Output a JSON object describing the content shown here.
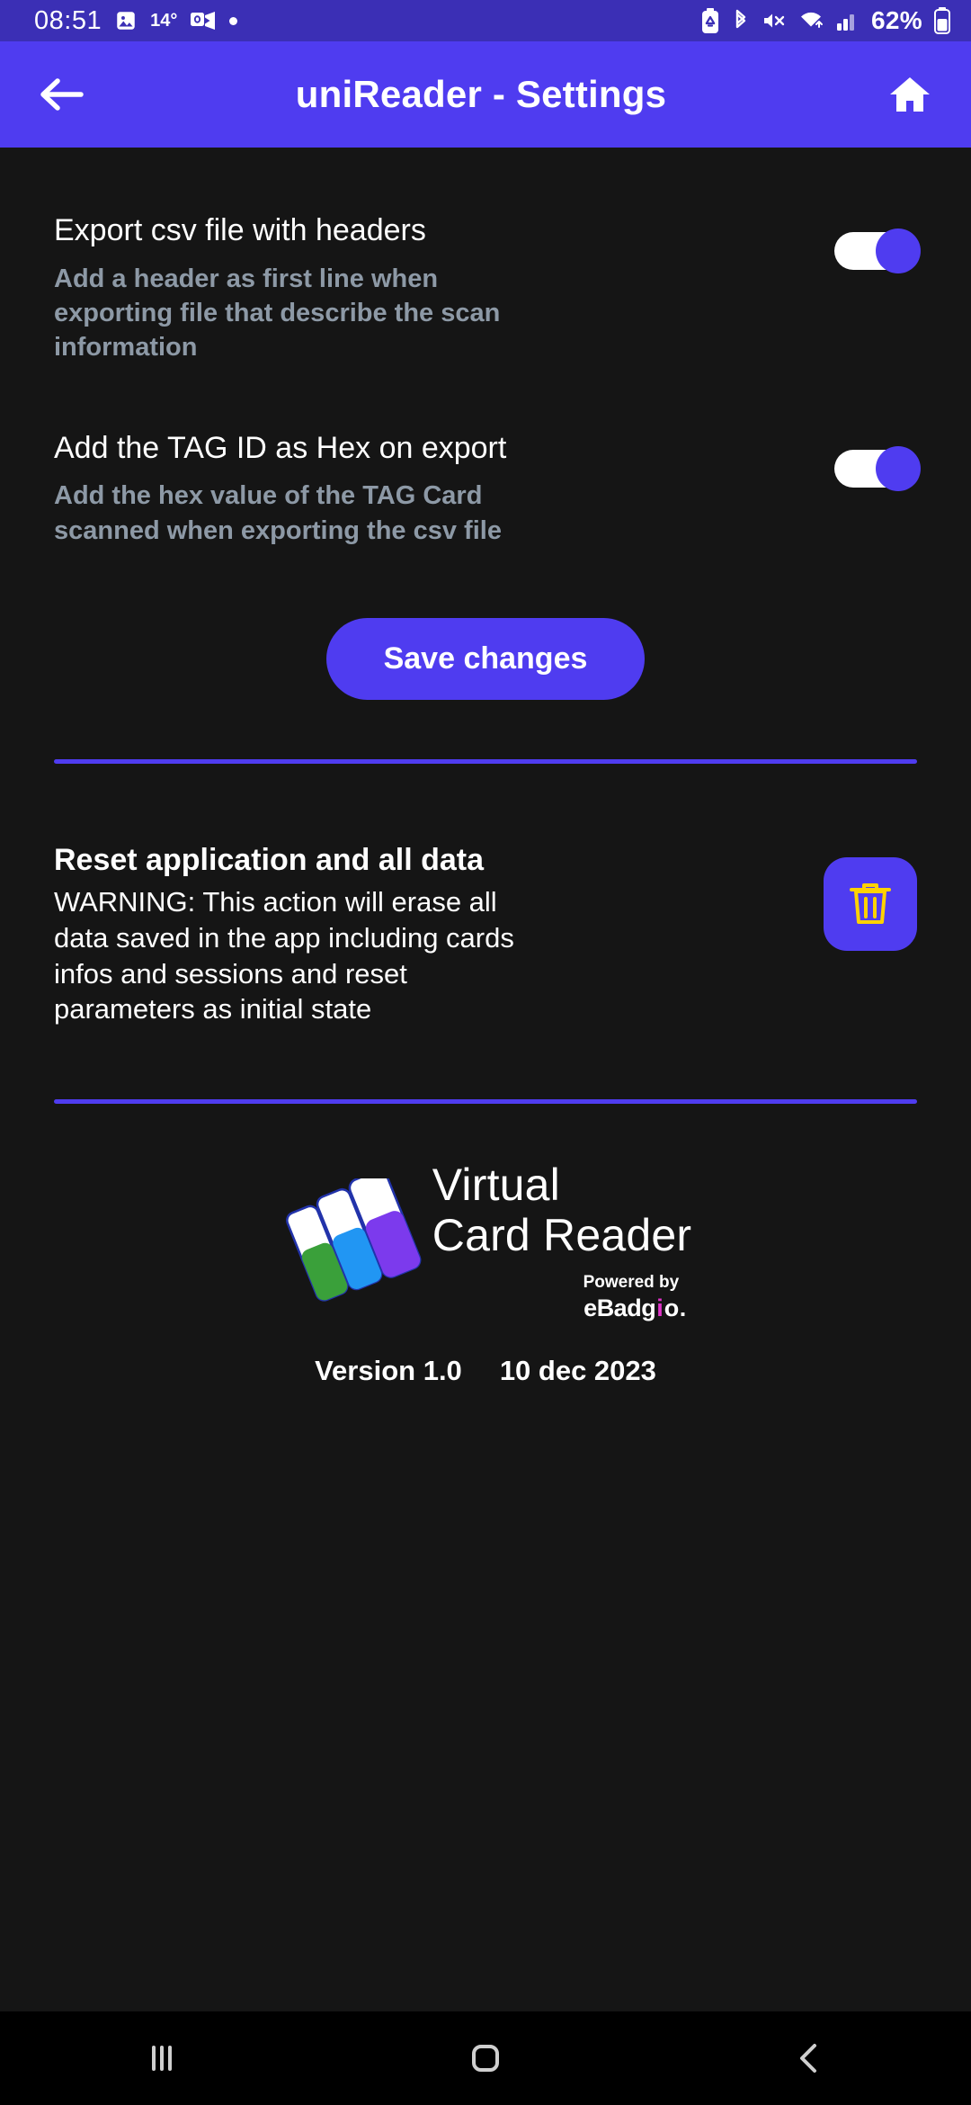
{
  "status_bar": {
    "time": "08:51",
    "temperature": "14°",
    "battery_percent": "62%",
    "icons": [
      "image-icon",
      "outlook-icon",
      "dot-indicator",
      "battery-saver-icon",
      "bluetooth-icon",
      "mute-icon",
      "wifi-icon",
      "signal-icon",
      "battery-icon"
    ],
    "background": "#3b2fb5"
  },
  "app_bar": {
    "title": "uniReader - Settings",
    "back_icon": "arrow-left-icon",
    "home_icon": "home-icon",
    "background": "#4f3cf0"
  },
  "settings": [
    {
      "title": "Export csv file with headers",
      "subtitle": "Add a header as first line when exporting file that describe the scan information",
      "toggle_on": true
    },
    {
      "title": "Add the TAG ID as Hex on export",
      "subtitle": "Add the hex value of the TAG Card scanned when exporting the csv file",
      "toggle_on": true
    }
  ],
  "save": {
    "label": "Save changes"
  },
  "reset": {
    "title": "Reset application and all data",
    "warning": "WARNING: This action will erase all data saved in the app including cards infos and sessions and reset parameters as initial state",
    "button_icon": "trash-icon"
  },
  "brand": {
    "logo_icon": "stacked-cards-logo",
    "name_line1": "Virtual",
    "name_line2": "Card Reader",
    "powered_by": "Powered by",
    "company_prefix": "eBadg",
    "company_accent": "i",
    "company_suffix": "o",
    "company_tail": ".",
    "logo_colors": {
      "green": "#3aa03a",
      "blue": "#2196f3",
      "purple": "#7c3aed",
      "white": "#ffffff"
    }
  },
  "version": {
    "number": "Version 1.0",
    "date": "10 dec 2023"
  },
  "nav_bar": {
    "recents_icon": "recents-icon",
    "home_icon": "home-square-icon",
    "back_icon": "back-chevron-icon"
  },
  "theme": {
    "accent": "#4f3cf0",
    "background": "#151515",
    "status_bar_bg": "#3b2fb5",
    "muted_text": "#8d99a6"
  }
}
